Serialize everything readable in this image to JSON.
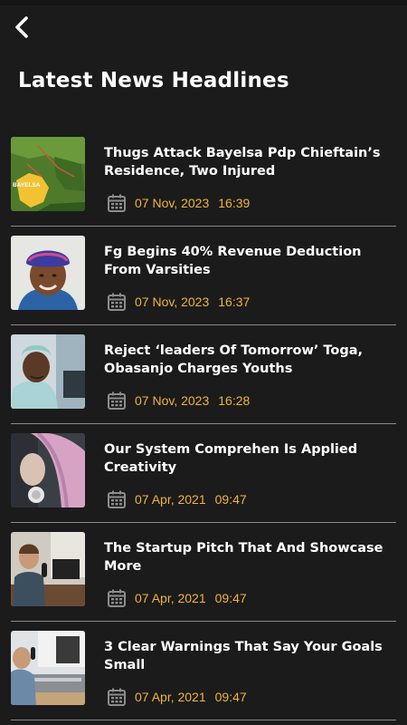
{
  "header": {
    "title": "Latest News Headlines",
    "back_icon": "chevron-left-icon"
  },
  "colors": {
    "background": "#1b1b1b",
    "accent": "#f0b43c",
    "divider": "#8a8a8a",
    "text": "#ffffff"
  },
  "news": [
    {
      "headline": "Thugs Attack Bayelsa Pdp Chieftain’s Residence, Two Injured",
      "date": "07 Nov, 2023",
      "time": "16:39",
      "thumb_icon": "bayelsa-map-image",
      "thumb_label": "BAYELSA"
    },
    {
      "headline": "Fg Begins 40% Revenue Deduction From Varsities",
      "date": "07 Nov, 2023",
      "time": "16:37",
      "thumb_icon": "woman-portrait-image"
    },
    {
      "headline": "Reject ‘leaders Of Tomorrow’ Toga, Obasanjo Charges Youths",
      "date": "07 Nov, 2023",
      "time": "16:28",
      "thumb_icon": "man-portrait-image"
    },
    {
      "headline": "Our System Comprehen Is Applied Creativity",
      "date": "07 Apr, 2021",
      "time": "09:47",
      "thumb_icon": "pink-hair-headphones-image"
    },
    {
      "headline": "The Startup Pitch That And Showcase More",
      "date": "07 Apr, 2021",
      "time": "09:47",
      "thumb_icon": "podcast-studio-image"
    },
    {
      "headline": "3 Clear Warnings That Say Your Goals Small",
      "date": "07 Apr, 2021",
      "time": "09:47",
      "thumb_icon": "radio-studio-image"
    }
  ]
}
